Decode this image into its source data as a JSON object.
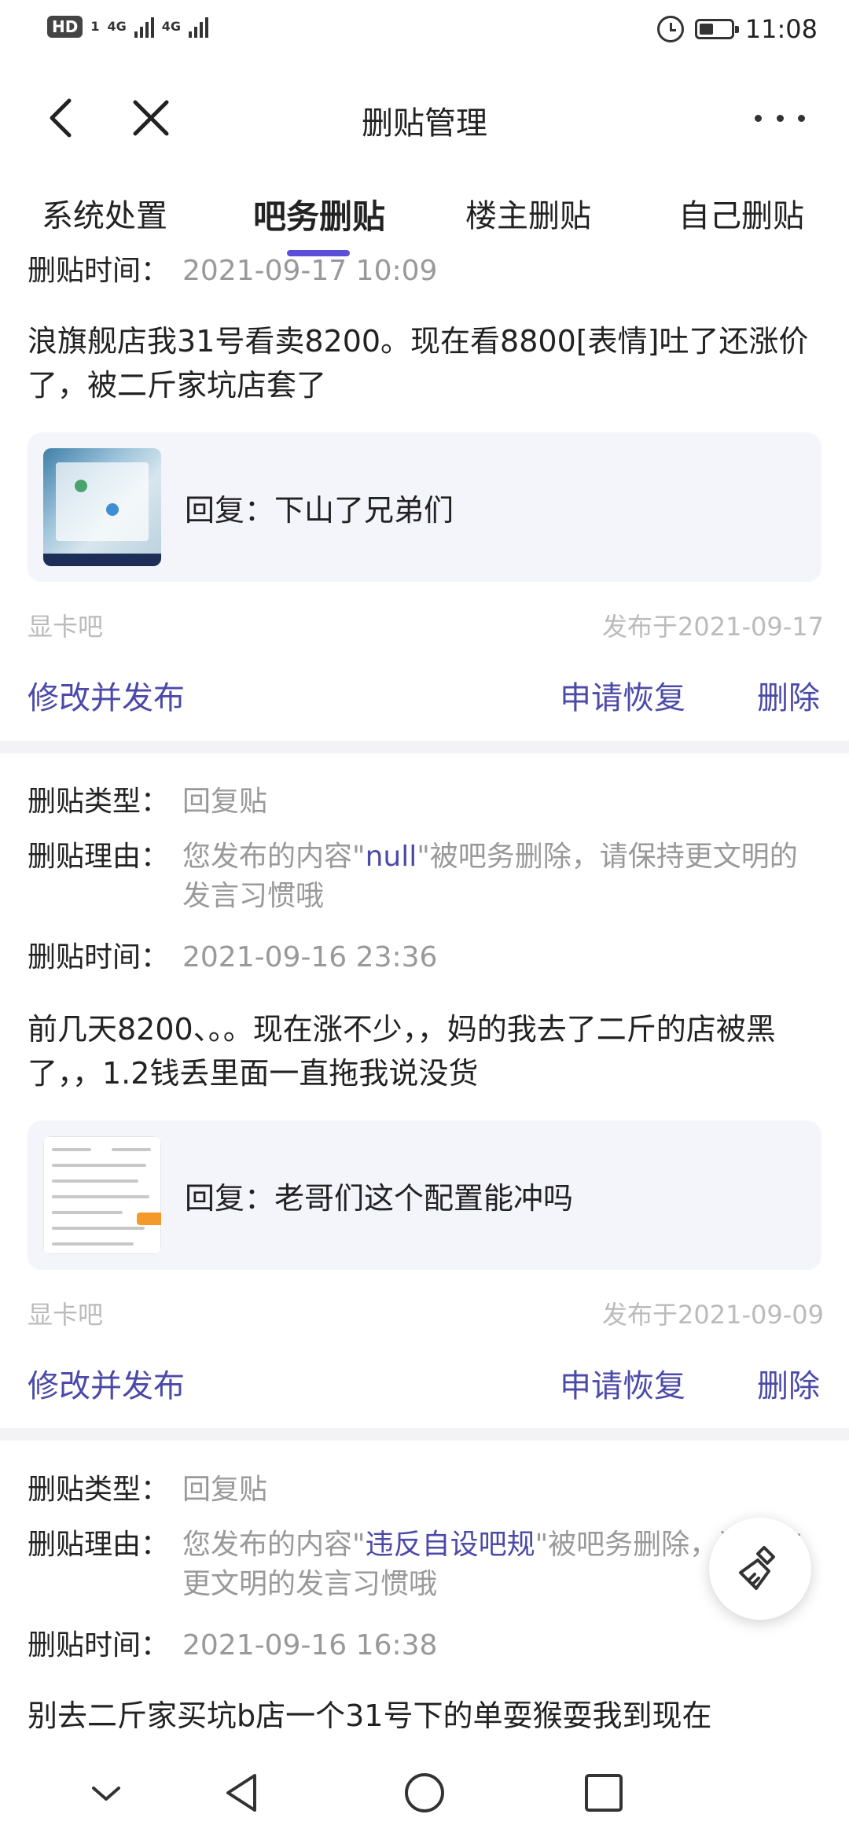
{
  "status_bar": {
    "hd_label": "HD",
    "sim_label": "1",
    "network_1": "4G",
    "network_2": "4G",
    "time": "11:08",
    "battery_level": 0.45
  },
  "header": {
    "title": "删贴管理"
  },
  "tabs": [
    {
      "label": "系统处置",
      "active": false
    },
    {
      "label": "吧务删贴",
      "active": true
    },
    {
      "label": "楼主删贴",
      "active": false
    },
    {
      "label": "自己删贴",
      "active": false
    }
  ],
  "labels": {
    "type": "删贴类型：",
    "reason": "删贴理由：",
    "time": "删贴时间："
  },
  "actions": {
    "edit": "修改并发布",
    "restore": "申请恢复",
    "delete": "删除"
  },
  "posts": [
    {
      "time": "2021-09-17 10:09",
      "content": "浪旗舰店我31号看卖8200。现在看8800[表情]吐了还涨价了，被二斤家坑店套了",
      "quote": "回复：下山了兄弟们",
      "forum": "显卡吧",
      "published": "发布于2021-09-17"
    },
    {
      "type": "回复贴",
      "reason_prefix": "您发布的内容\"",
      "reason_highlight": "null",
      "reason_suffix": "\"被吧务删除，请保持更文明的发言习惯哦",
      "time": "2021-09-16 23:36",
      "content": "前几天8200、。。现在涨不少，，妈的我去了二斤的店被黑了，，1.2钱丢里面一直拖我说没货",
      "quote": "回复：老哥们这个配置能冲吗",
      "forum": "显卡吧",
      "published": "发布于2021-09-09"
    },
    {
      "type": "回复贴",
      "reason_prefix": "您发布的内容\"",
      "reason_highlight": "违反自设吧规",
      "reason_suffix": "\"被吧务删除，请保持更文明的发言习惯哦",
      "time": "2021-09-16 16:38",
      "content": "别去二斤家买坑b店一个31号下的单耍猴耍我到现在"
    }
  ],
  "colors": {
    "accent": "#4c4aa8",
    "indicator": "#5b4fd8",
    "muted": "#999999",
    "quote_bg": "#f4f4fb",
    "divider": "#f3f3f6"
  },
  "icons": {
    "back": "chevron-left-icon",
    "close": "close-icon",
    "more": "more-horizontal-icon",
    "fab": "broom-icon",
    "nav_hide": "chevron-down-icon",
    "nav_back": "triangle-back-icon",
    "nav_home": "circle-home-icon",
    "nav_recents": "square-recents-icon"
  }
}
